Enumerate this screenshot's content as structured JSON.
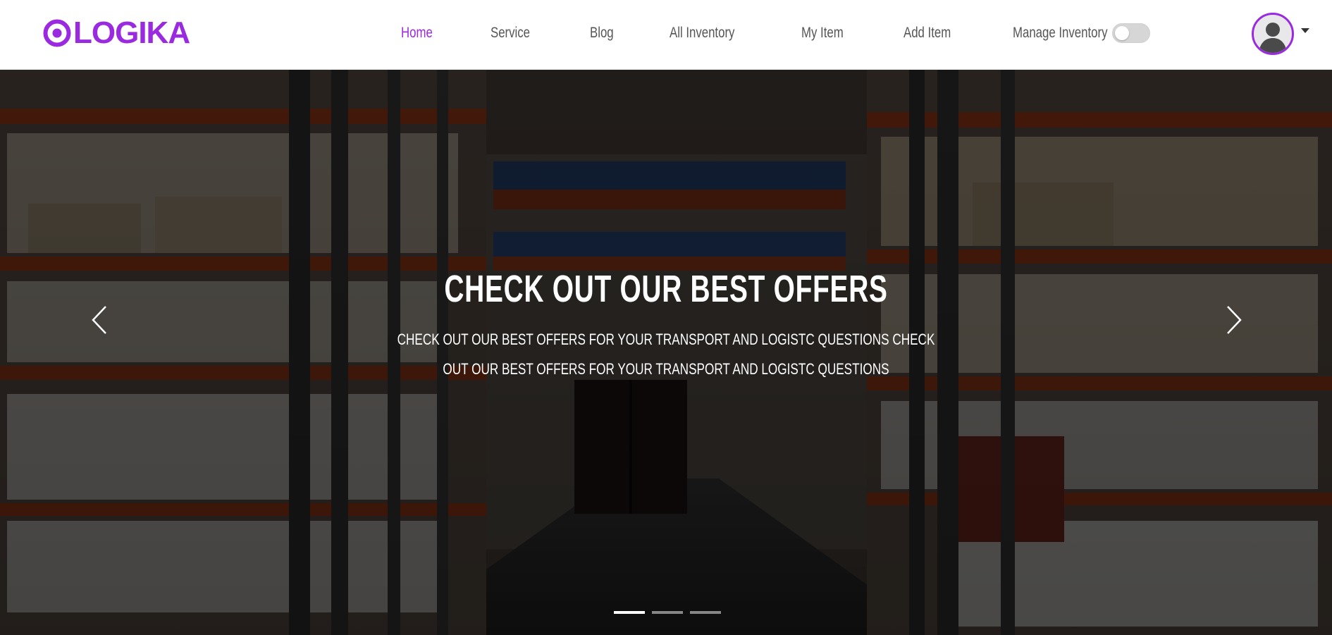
{
  "brand": {
    "name": "LOGIKA",
    "color": "#9a2ae0"
  },
  "nav": {
    "items": [
      {
        "label": "Home",
        "active": true
      },
      {
        "label": "Service"
      },
      {
        "label": "Blog"
      },
      {
        "label": "All Inventory"
      },
      {
        "label": "My Item"
      },
      {
        "label": "Add Item"
      },
      {
        "label": "Manage Inventory"
      }
    ],
    "active_color": "#9a2ae0"
  },
  "theme_toggle": {
    "on": false
  },
  "user_menu": {
    "avatar_icon": "user-silhouette-icon",
    "dropdown_icon": "caret-down-icon"
  },
  "hero": {
    "title": "CHECK OUT OUR BEST OFFERS",
    "subtitle": "CHECK OUT OUR BEST OFFERS FOR YOUR TRANSPORT AND LOGISTC QUESTIONS CHECK OUT OUR BEST OFFERS FOR YOUR TRANSPORT AND LOGISTC QUESTIONS",
    "prev_icon": "chevron-left-icon",
    "next_icon": "chevron-right-icon",
    "slides_count": 3,
    "active_slide": 1
  }
}
